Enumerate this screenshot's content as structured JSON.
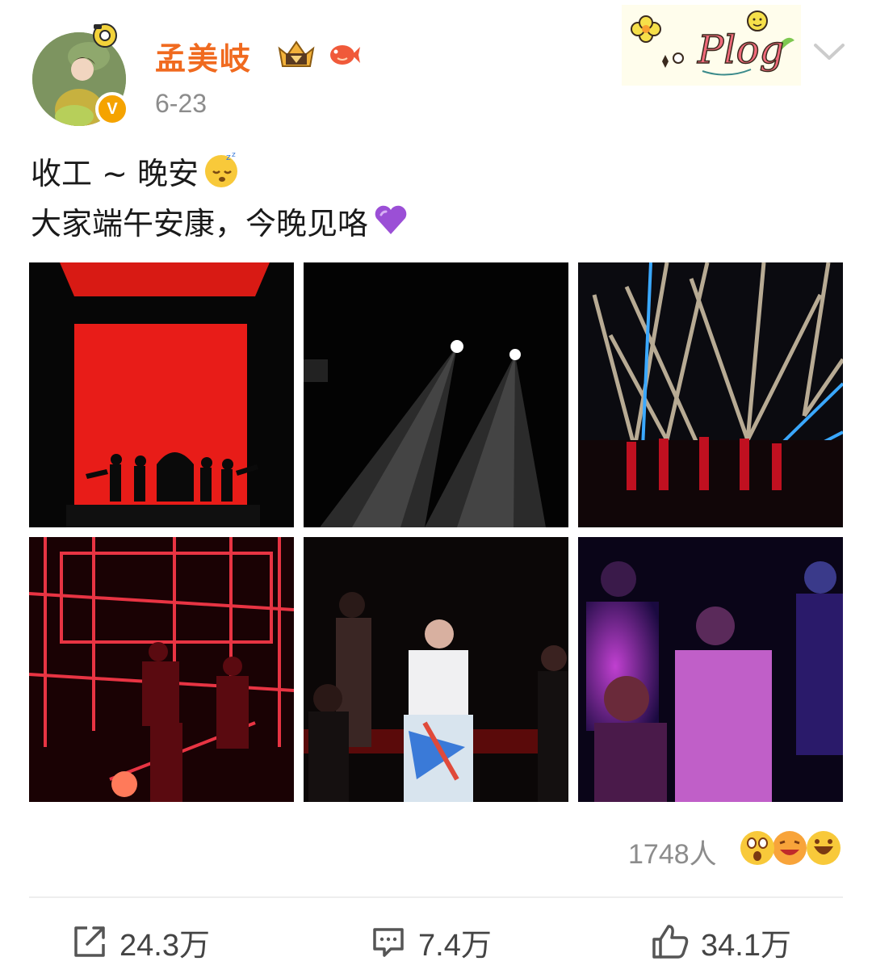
{
  "post": {
    "username": "孟美岐",
    "date": "6-23",
    "text_line1": "收工 ~ 晚安",
    "text_line2": "大家端午安康，今晚见咯",
    "verified_badge": "V",
    "sticker_text": "Plog"
  },
  "reactions": {
    "count_label": "1748人"
  },
  "actions": {
    "repost_count": "24.3万",
    "comment_count": "7.4万",
    "like_count": "34.1万"
  },
  "colors": {
    "username": "#f06a1f",
    "badge": "#f5a300",
    "meta_gray": "#8c8c8c"
  },
  "icons": {
    "verified": "verified-v-icon",
    "member": "crown-icon",
    "fish": "koi-fish-icon",
    "more": "chevron-down-icon",
    "repost": "share-arrow-icon",
    "comment": "comment-icon",
    "like": "thumbs-up-icon"
  }
}
